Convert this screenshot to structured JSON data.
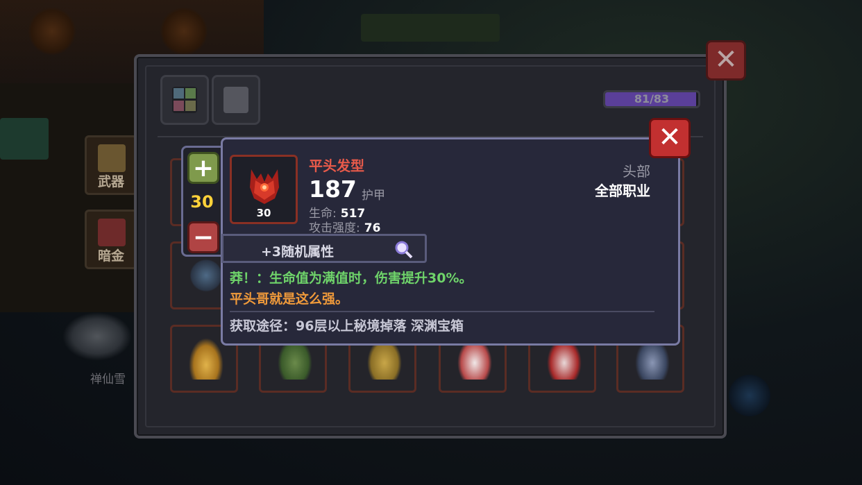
{
  "background": {
    "npc_name": "禅仙雪",
    "side_tabs": [
      {
        "label": "武器",
        "icon": "weapon-tab-icon"
      },
      {
        "label": "暗金",
        "icon": "dark-gold-tab-icon"
      }
    ]
  },
  "window": {
    "tabs": [
      {
        "icon": "grid-tab-icon"
      },
      {
        "icon": "armor-tab-icon"
      }
    ],
    "capacity": "81/83",
    "capacity_fraction": 0.976
  },
  "stepper": {
    "plus": "+",
    "minus": "−",
    "value": "30"
  },
  "item": {
    "name": "平头发型",
    "level": "30",
    "armor_value": "187",
    "armor_label": "护甲",
    "stats": [
      {
        "label": "生命:",
        "value": "517"
      },
      {
        "label": "攻击强度:",
        "value": "76"
      }
    ],
    "slot_type": "头部",
    "class_requirement": "全部职业",
    "random_attributes": "+3随机属性",
    "effect": "莽！：生命值为满值时，伤害提升30%。",
    "flavor": "平头哥就是这么强。",
    "source": "获取途径：96层以上秘境掉落 深渊宝箱",
    "name_color": "#e85a4a",
    "effect_color": "#6fd46a",
    "flavor_color": "#f09a3a"
  },
  "buttons": {
    "close_tooltip": "✕",
    "close_window": "✕"
  },
  "slots": [
    {
      "icon": "golden-spiky-hair-icon"
    },
    {
      "icon": "green-helmet-icon"
    },
    {
      "icon": "yellow-robe-icon"
    },
    {
      "icon": "white-dress-icon"
    },
    {
      "icon": "red-cloak-icon"
    },
    {
      "icon": "blue-armor-icon"
    }
  ]
}
